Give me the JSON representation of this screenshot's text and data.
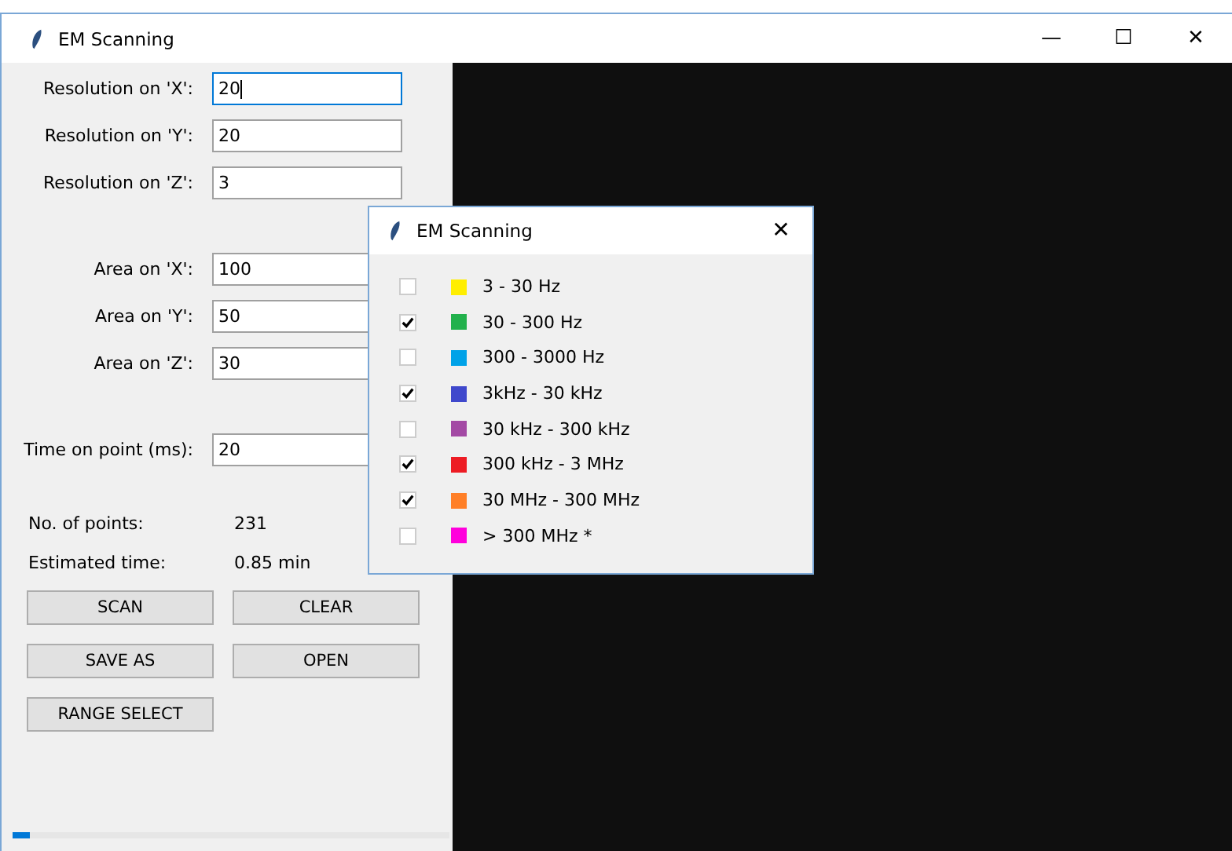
{
  "window": {
    "title": "EM Scanning",
    "controls": [
      "—",
      "☐",
      "✕"
    ]
  },
  "field_groups": [
    [
      {
        "label": "Resolution on 'X':",
        "value": "20",
        "focused": true
      },
      {
        "label": "Resolution on 'Y':",
        "value": "20",
        "focused": false
      },
      {
        "label": "Resolution on 'Z':",
        "value": "3",
        "focused": false
      }
    ],
    [
      {
        "label": "Area on 'X':",
        "value": "100",
        "focused": false
      },
      {
        "label": "Area on 'Y':",
        "value": "50",
        "focused": false
      },
      {
        "label": "Area on 'Z':",
        "value": "30",
        "focused": false
      }
    ],
    [
      {
        "label": "Time on point (ms):",
        "value": "20",
        "focused": false
      }
    ]
  ],
  "info": [
    {
      "label": "No. of points:",
      "value": "231"
    },
    {
      "label": "Estimated time:",
      "value": "0.85 min"
    }
  ],
  "buttons": [
    "SCAN",
    "CLEAR",
    "SAVE AS",
    "OPEN",
    "RANGE SELECT"
  ],
  "progress": {
    "level": 0.04
  },
  "dialog": {
    "title": "EM Scanning",
    "close": "✕",
    "bands": [
      {
        "label": "3 - 30 Hz",
        "checked": false,
        "color": "#ffee00"
      },
      {
        "label": "30 - 300 Hz",
        "checked": true,
        "color": "#22b14c"
      },
      {
        "label": "300 - 3000 Hz",
        "checked": false,
        "color": "#00a2e8"
      },
      {
        "label": "3kHz - 30 kHz",
        "checked": true,
        "color": "#3f48cc"
      },
      {
        "label": "30 kHz - 300 kHz",
        "checked": false,
        "color": "#a349a4"
      },
      {
        "label": "300 kHz - 3 MHz",
        "checked": true,
        "color": "#ed1c24"
      },
      {
        "label": "30 MHz - 300 MHz",
        "checked": true,
        "color": "#ff7f27"
      },
      {
        "label": "> 300 MHz *",
        "checked": false,
        "color": "#ff00dc"
      }
    ]
  }
}
